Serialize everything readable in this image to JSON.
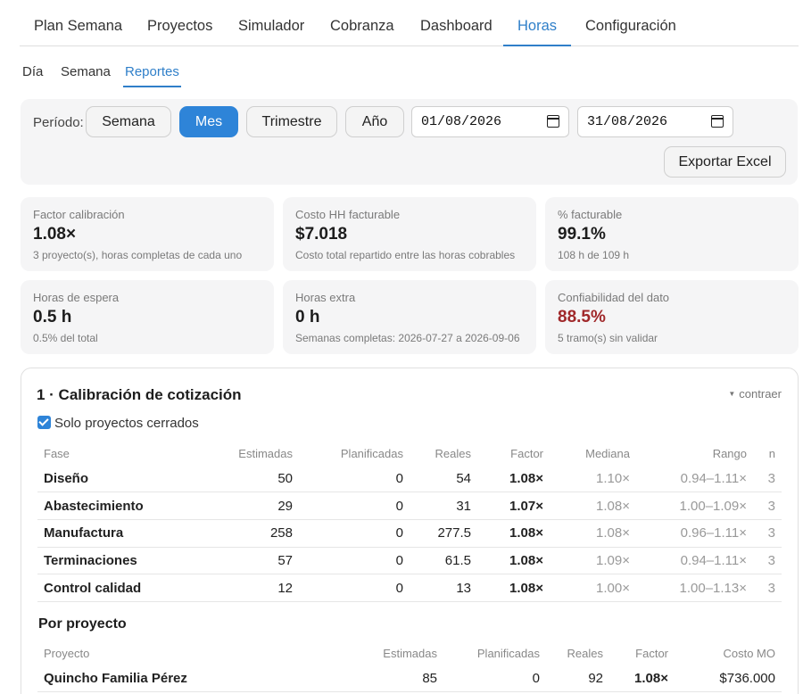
{
  "nav": {
    "tabs": [
      "Plan Semana",
      "Proyectos",
      "Simulador",
      "Cobranza",
      "Dashboard",
      "Horas",
      "Configuración"
    ],
    "active": "Horas"
  },
  "subnav": {
    "tabs": [
      "Día",
      "Semana",
      "Reportes"
    ],
    "active": "Reportes"
  },
  "filter": {
    "label": "Período:",
    "periods": [
      "Semana",
      "Mes",
      "Trimestre",
      "Año"
    ],
    "active_period": "Mes",
    "date_from": "01/08/2026",
    "date_to": "31/08/2026",
    "export_label": "Exportar Excel"
  },
  "cards": {
    "factor": {
      "title": "Factor calibración",
      "value": "1.08×",
      "sub": "3 proyecto(s), horas completas de cada uno"
    },
    "costo": {
      "title": "Costo HH facturable",
      "value": "$7.018",
      "sub": "Costo total repartido entre las horas cobrables"
    },
    "facturable": {
      "title": "% facturable",
      "value": "99.1%",
      "sub": "108 h de 109 h"
    },
    "espera": {
      "title": "Horas de espera",
      "value": "0.5 h",
      "sub": "0.5% del total"
    },
    "extra": {
      "title": "Horas extra",
      "value": "0 h",
      "sub": "Semanas completas: 2026-07-27 a 2026-09-06"
    },
    "confiabilidad": {
      "title": "Confiabilidad del dato",
      "value": "88.5%",
      "sub": "5 tramo(s) sin validar",
      "value_color": "#a0282a"
    }
  },
  "calibration": {
    "title": "1 · Calibración de cotización",
    "collapse_label": "contraer",
    "checkbox_label": "Solo proyectos cerrados",
    "checkbox_checked": true,
    "phase_headers": [
      "Fase",
      "Estimadas",
      "Planificadas",
      "Reales",
      "Factor",
      "Mediana",
      "Rango",
      "n"
    ],
    "phase_rows": [
      [
        "Diseño",
        "50",
        "0",
        "54",
        "1.08×",
        "1.10×",
        "0.94–1.11×",
        "3"
      ],
      [
        "Abastecimiento",
        "29",
        "0",
        "31",
        "1.07×",
        "1.08×",
        "1.00–1.09×",
        "3"
      ],
      [
        "Manufactura",
        "258",
        "0",
        "277.5",
        "1.08×",
        "1.08×",
        "0.96–1.11×",
        "3"
      ],
      [
        "Terminaciones",
        "57",
        "0",
        "61.5",
        "1.08×",
        "1.09×",
        "0.94–1.11×",
        "3"
      ],
      [
        "Control calidad",
        "12",
        "0",
        "13",
        "1.08×",
        "1.00×",
        "1.00–1.13×",
        "3"
      ]
    ],
    "project_section_title": "Por proyecto",
    "project_headers": [
      "Proyecto",
      "Estimadas",
      "Planificadas",
      "Reales",
      "Factor",
      "Costo MO"
    ],
    "project_rows": [
      [
        "Quincho Familia Pérez",
        "85",
        "0",
        "92",
        "1.08×",
        "$736.000"
      ]
    ]
  },
  "colors": {
    "accent": "#2e84d8",
    "tab_active": "#2f7fc9",
    "warning_value": "#a0282a"
  }
}
